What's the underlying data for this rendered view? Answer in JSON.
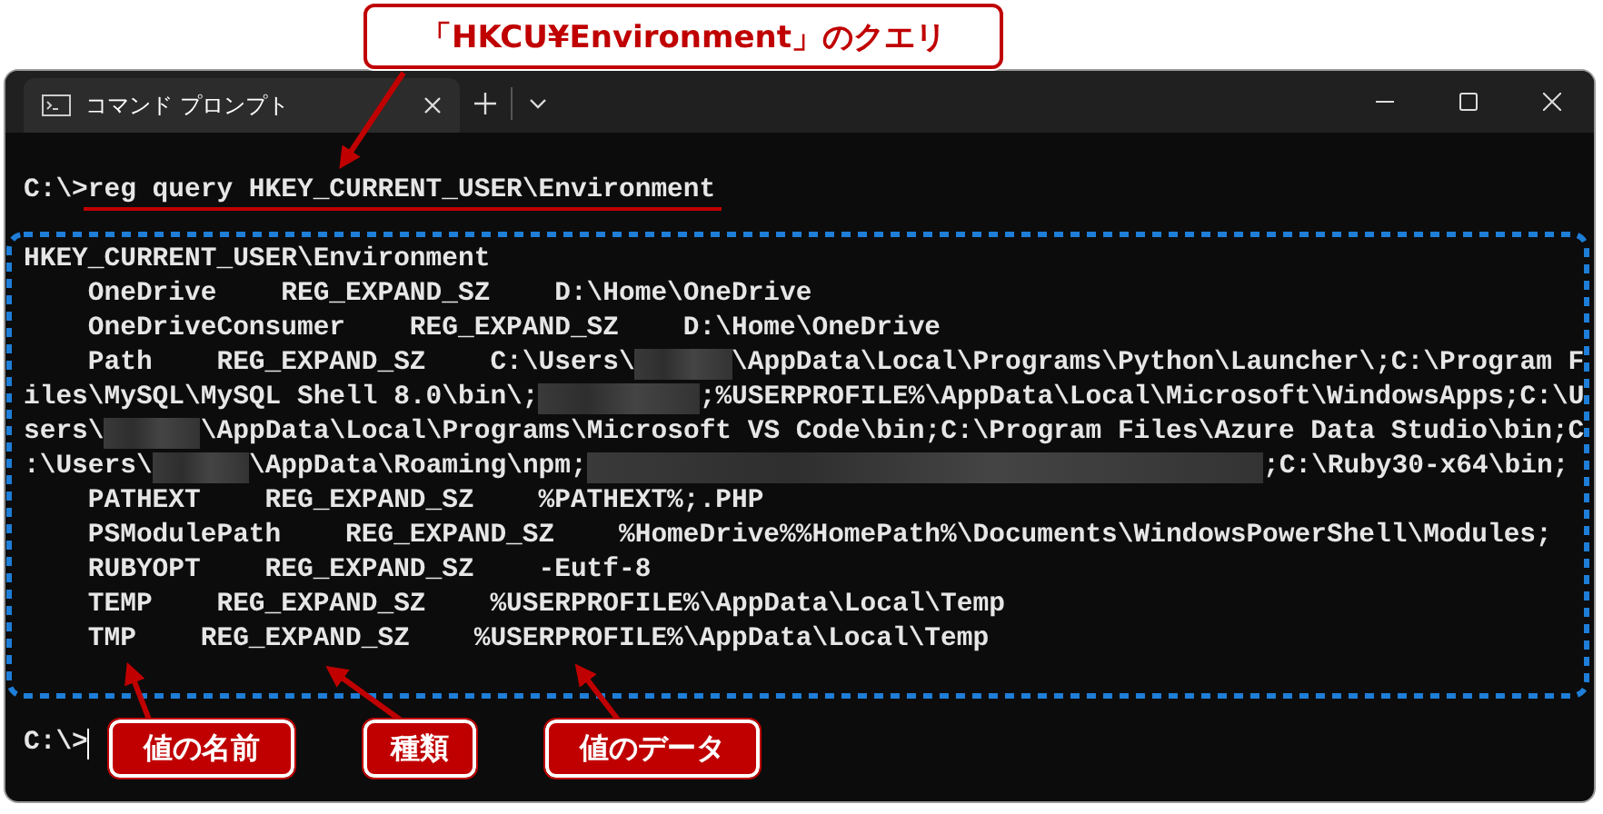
{
  "annotations": {
    "title_callout": "「HKCU¥Environment」のクエリ",
    "bottom_callouts": [
      "値の名前",
      "種類",
      "値のデータ"
    ]
  },
  "window": {
    "tabs": [
      {
        "title": "コマンド プロンプト",
        "selected": true
      }
    ]
  },
  "terminal": {
    "command_prompt": "C:\\>",
    "command": "reg query HKEY_CURRENT_USER\\Environment",
    "output_lines": [
      {
        "segments": [
          {
            "kind": "text",
            "text": "HKEY_CURRENT_USER\\Environment"
          }
        ]
      },
      {
        "segments": [
          {
            "kind": "text",
            "text": "    OneDrive    REG_EXPAND_SZ    D:\\Home\\OneDrive"
          }
        ]
      },
      {
        "segments": [
          {
            "kind": "text",
            "text": "    OneDriveConsumer    REG_EXPAND_SZ    D:\\Home\\OneDrive"
          }
        ]
      },
      {
        "segments": [
          {
            "kind": "text",
            "text": "    Path    REG_EXPAND_SZ    C:\\Users\\"
          },
          {
            "kind": "redacted_short"
          },
          {
            "kind": "text",
            "text": "\\AppData\\Local\\Programs\\Python\\Launcher\\;C:\\Program F"
          }
        ]
      },
      {
        "segments": [
          {
            "kind": "text",
            "text": "iles\\MySQL\\MySQL Shell 8.0\\bin\\;"
          },
          {
            "kind": "redacted_medium"
          },
          {
            "kind": "text",
            "text": ";%USERPROFILE%\\AppData\\Local\\Microsoft\\WindowsApps;C:\\U"
          }
        ]
      },
      {
        "segments": [
          {
            "kind": "text",
            "text": "sers\\"
          },
          {
            "kind": "redacted_short"
          },
          {
            "kind": "text",
            "text": "\\AppData\\Local\\Programs\\Microsoft VS Code\\bin;C:\\Program Files\\Azure Data Studio\\bin;C"
          }
        ]
      },
      {
        "segments": [
          {
            "kind": "text",
            "text": ":\\Users\\"
          },
          {
            "kind": "redacted_short"
          },
          {
            "kind": "text",
            "text": "\\AppData\\Roaming\\npm;"
          },
          {
            "kind": "redacted_long"
          },
          {
            "kind": "text",
            "text": ";C:\\Ruby30-x64\\bin;"
          }
        ]
      },
      {
        "segments": [
          {
            "kind": "text",
            "text": "    PATHEXT    REG_EXPAND_SZ    %PATHEXT%;.PHP"
          }
        ]
      },
      {
        "segments": [
          {
            "kind": "text",
            "text": "    PSModulePath    REG_EXPAND_SZ    %HomeDrive%%HomePath%\\Documents\\WindowsPowerShell\\Modules;"
          }
        ]
      },
      {
        "segments": [
          {
            "kind": "text",
            "text": "    RUBYOPT    REG_EXPAND_SZ    -Eutf-8"
          }
        ]
      },
      {
        "segments": [
          {
            "kind": "text",
            "text": "    TEMP    REG_EXPAND_SZ    %USERPROFILE%\\AppData\\Local\\Temp"
          }
        ]
      },
      {
        "segments": [
          {
            "kind": "text",
            "text": "    TMP    REG_EXPAND_SZ    %USERPROFILE%\\AppData\\Local\\Temp"
          }
        ]
      }
    ],
    "final_prompt": "C:\\>"
  }
}
